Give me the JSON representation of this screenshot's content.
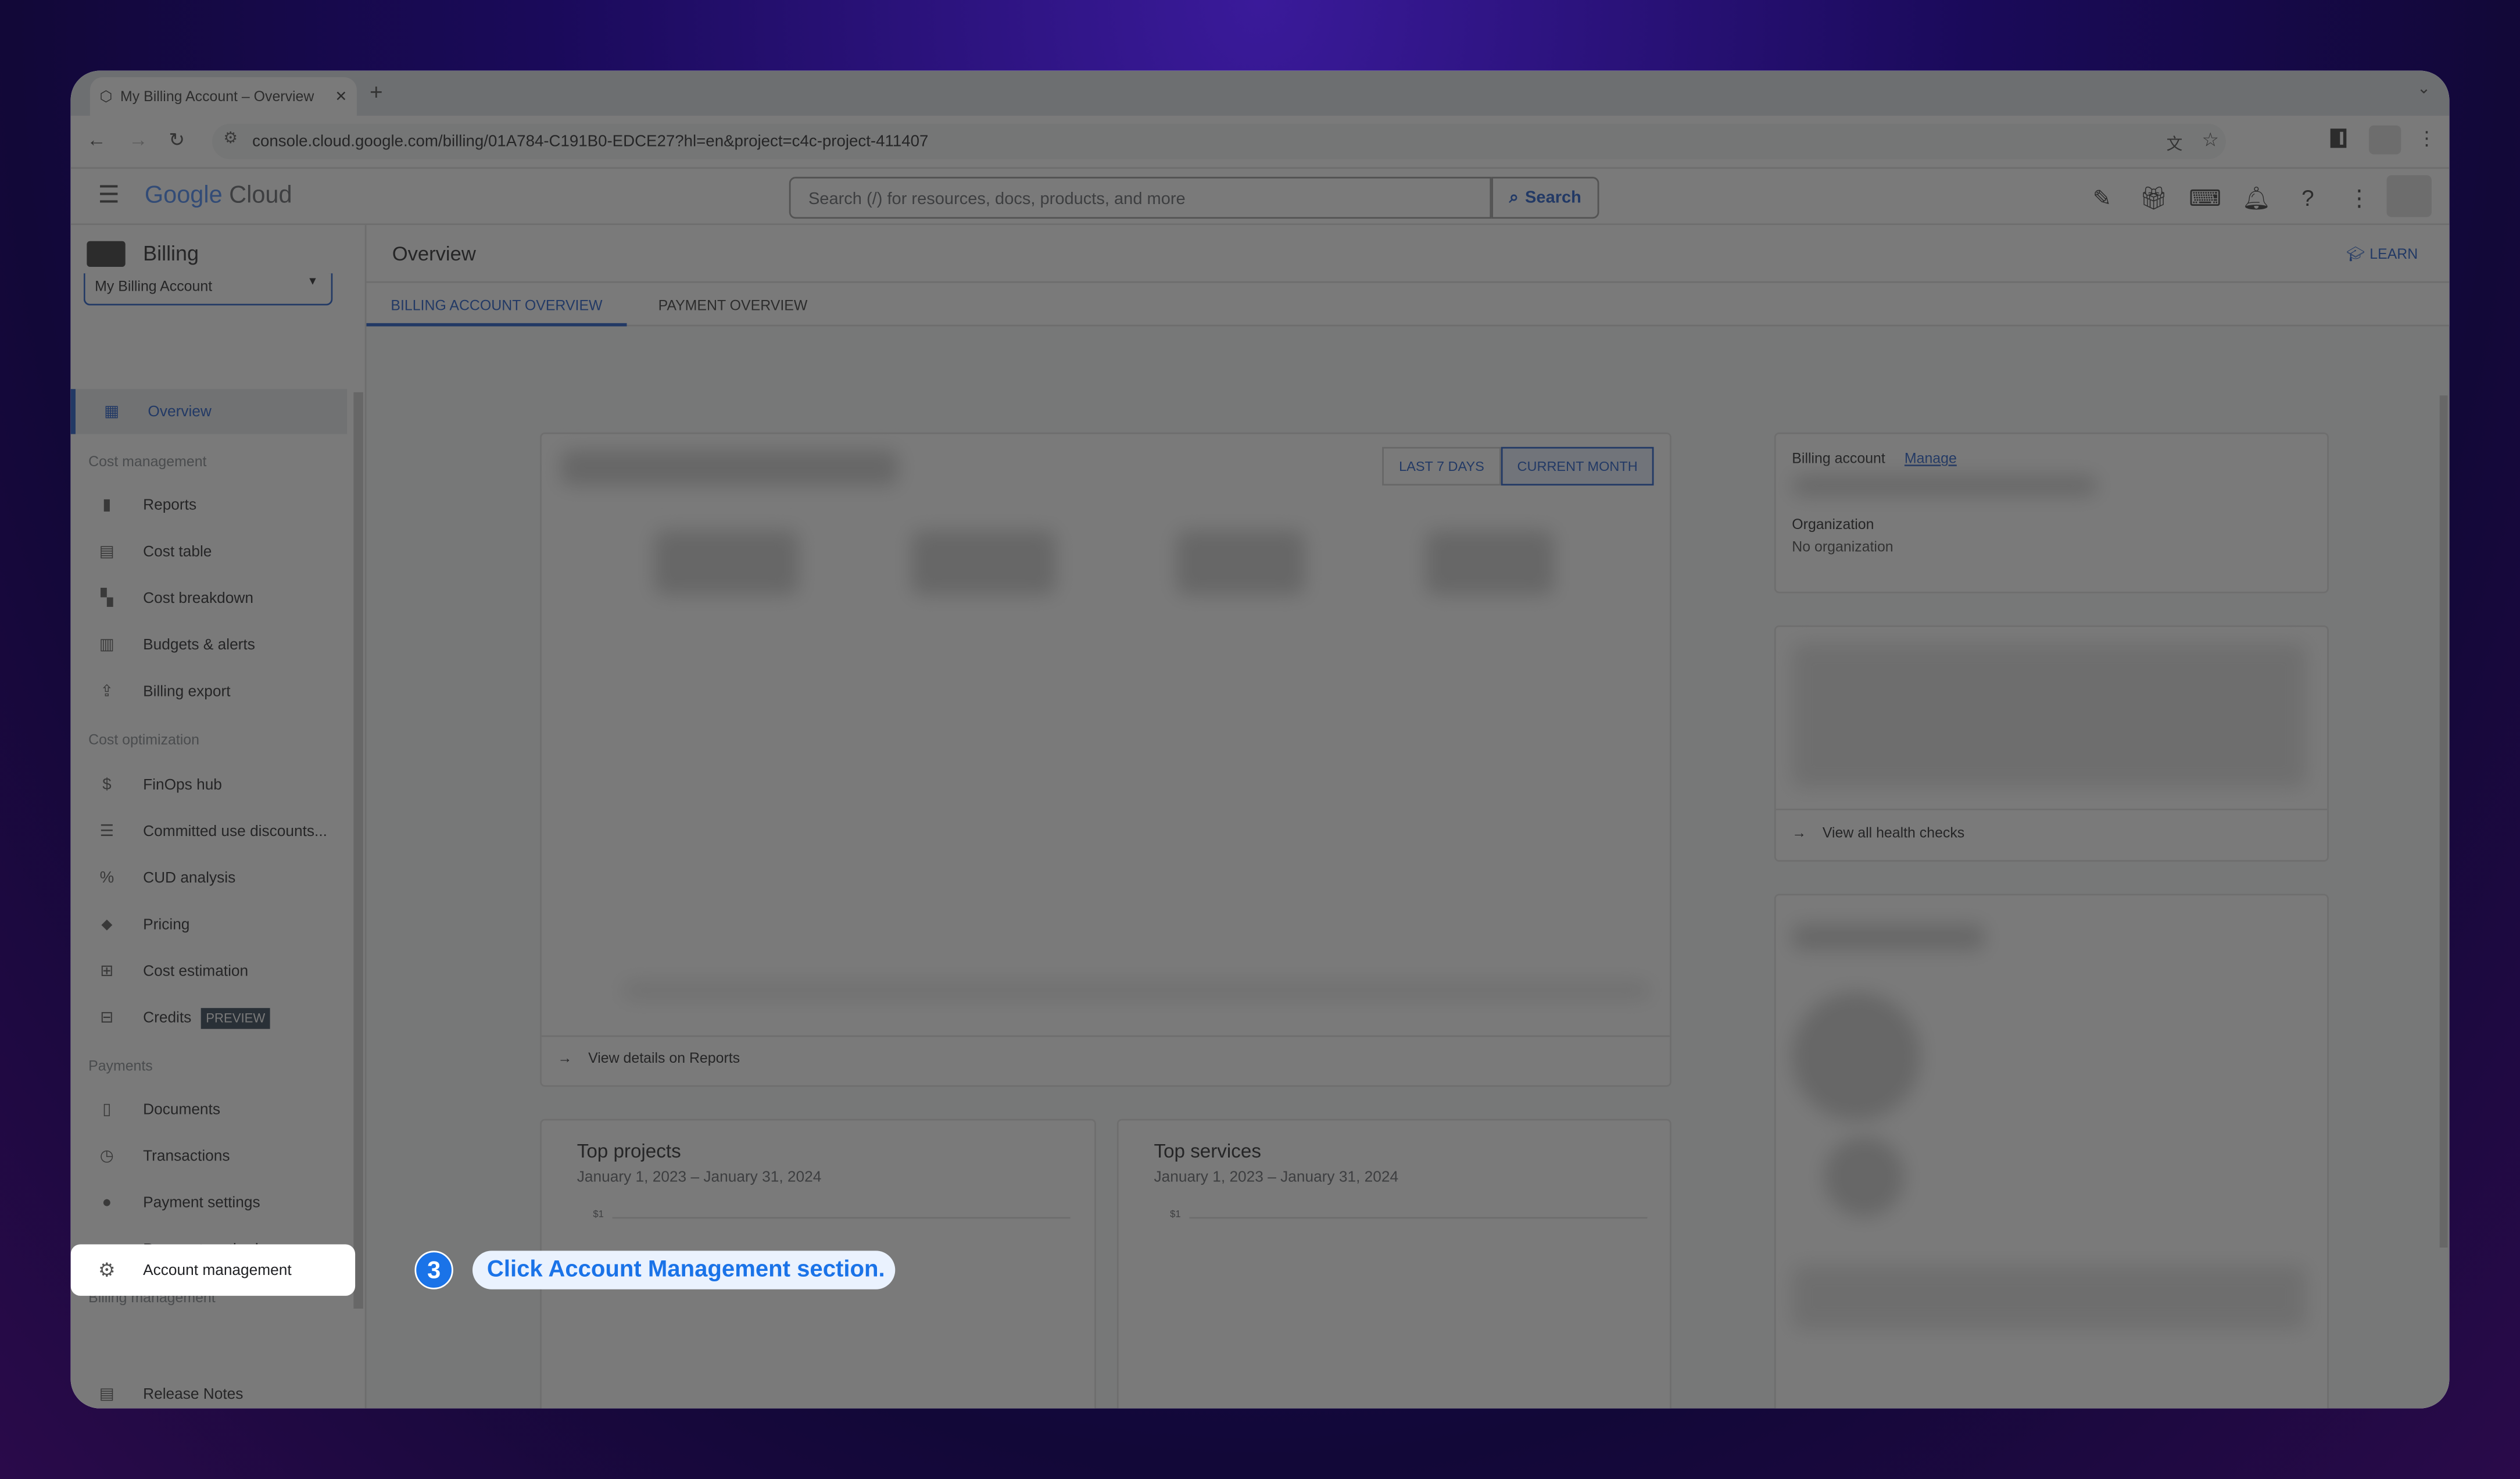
{
  "browser": {
    "tab_title": "My Billing Account – Overview",
    "url": "console.cloud.google.com/billing/01A784-C191B0-EDCE27?hl=en&project=c4c-project-411407"
  },
  "header": {
    "logo_google": "Google",
    "logo_cloud": "Cloud",
    "search_placeholder": "Search (/) for resources, docs, products, and more",
    "search_button": "Search"
  },
  "sidebar": {
    "title": "Billing",
    "account_select": "My Billing Account",
    "overview": "Overview",
    "sections": {
      "cost_management": "Cost management",
      "cost_optimization": "Cost optimization",
      "payments": "Payments",
      "billing_management": "Billing management"
    },
    "items": {
      "reports": "Reports",
      "cost_table": "Cost table",
      "cost_breakdown": "Cost breakdown",
      "budgets": "Budgets & alerts",
      "billing_export": "Billing export",
      "finops": "FinOps hub",
      "cud": "Committed use discounts...",
      "cud_analysis": "CUD analysis",
      "pricing": "Pricing",
      "cost_estimation": "Cost estimation",
      "credits": "Credits",
      "credits_badge": "PREVIEW",
      "documents": "Documents",
      "transactions": "Transactions",
      "payment_settings": "Payment settings",
      "payment_method": "Payment method",
      "account_management": "Account management",
      "release_notes": "Release Notes"
    }
  },
  "main": {
    "title": "Overview",
    "learn": "LEARN",
    "tabs": [
      "BILLING ACCOUNT OVERVIEW",
      "PAYMENT OVERVIEW"
    ],
    "range_buttons": [
      "LAST 7 DAYS",
      "CURRENT MONTH"
    ],
    "view_reports": "View details on Reports",
    "billing_account_label": "Billing account",
    "manage": "Manage",
    "organization_label": "Organization",
    "organization_value": "No organization",
    "view_health": "View all health checks",
    "top_projects": {
      "title": "Top projects",
      "range": "January 1, 2023 – January 31, 2024",
      "tick": "$1"
    },
    "top_services": {
      "title": "Top services",
      "range": "January 1, 2023 – January 31, 2024",
      "tick": "$1"
    }
  },
  "callout": {
    "step": "3",
    "text": "Click Account Management section."
  },
  "colors": {
    "accent": "#1a73e8",
    "active_nav": "#1a56c8"
  }
}
